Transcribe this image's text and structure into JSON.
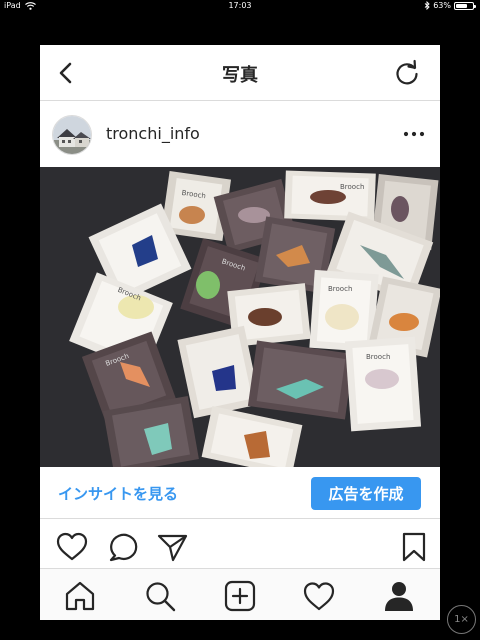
{
  "status_bar": {
    "device": "iPad",
    "time": "17:03",
    "battery_text": "63%",
    "battery_level": 0.63
  },
  "nav": {
    "title": "写真",
    "back_icon": "chevron-left-icon",
    "refresh_icon": "refresh-icon"
  },
  "post": {
    "username": "tronchi_info",
    "more_icon": "more-horizontal-icon"
  },
  "photo": {
    "label_text": "Brooch"
  },
  "insights": {
    "link_label": "インサイトを見る",
    "promote_label": "広告を作成"
  },
  "actions": [
    "heart-icon",
    "comment-icon",
    "share-icon",
    "bookmark-icon"
  ],
  "tabbar": [
    "home-icon",
    "search-icon",
    "add-icon",
    "activity-heart-icon",
    "profile-icon"
  ],
  "zoom": {
    "label": "1×"
  },
  "colors": {
    "accent": "#3897f0",
    "text": "#262626",
    "border": "#dbdbdb"
  }
}
